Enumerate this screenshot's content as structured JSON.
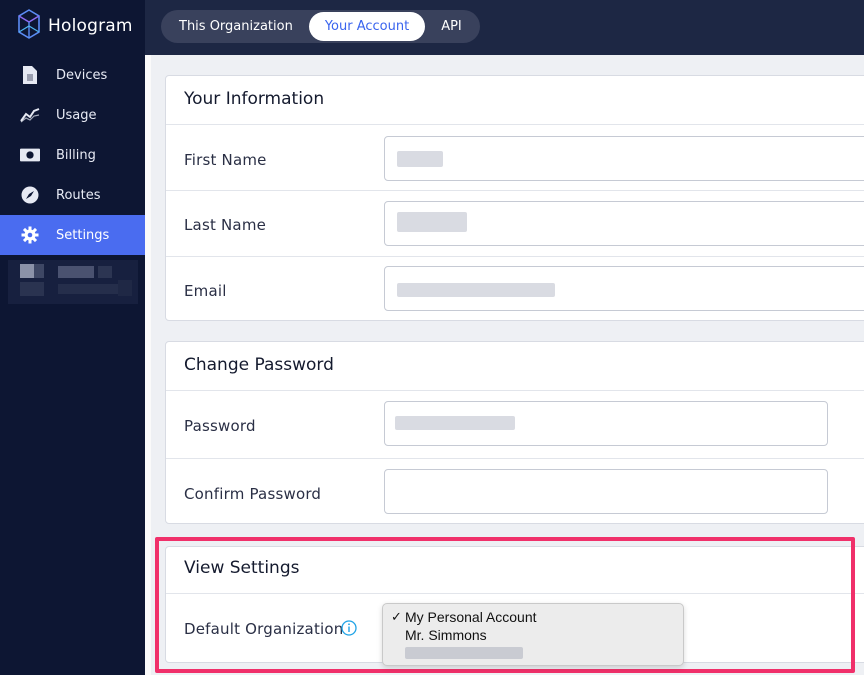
{
  "app": {
    "name": "Hologram"
  },
  "sidebar": {
    "items": [
      {
        "label": "Devices",
        "icon": "sim-card-icon"
      },
      {
        "label": "Usage",
        "icon": "line-chart-icon"
      },
      {
        "label": "Billing",
        "icon": "money-icon"
      },
      {
        "label": "Routes",
        "icon": "compass-icon"
      },
      {
        "label": "Settings",
        "icon": "gear-icon",
        "active": true
      }
    ]
  },
  "tabs": [
    {
      "label": "This Organization",
      "active": false
    },
    {
      "label": "Your Account",
      "active": true
    },
    {
      "label": "API",
      "active": false
    }
  ],
  "your_information": {
    "title": "Your Information",
    "first_name_label": "First Name",
    "last_name_label": "Last Name",
    "email_label": "Email"
  },
  "change_password": {
    "title": "Change Password",
    "password_label": "Password",
    "confirm_label": "Confirm Password"
  },
  "view_settings": {
    "title": "View Settings",
    "default_org_label": "Default Organization",
    "options": [
      {
        "label": "My Personal Account",
        "selected": true,
        "check": "✓"
      },
      {
        "label": "Mr. Simmons",
        "selected": false
      }
    ]
  },
  "colors": {
    "sidebar_bg": "#0d1633",
    "active_nav": "#4a6cf0",
    "accent_text": "#3a64ee",
    "highlight_border": "#f0306a",
    "info_icon": "#1fa3e6"
  }
}
